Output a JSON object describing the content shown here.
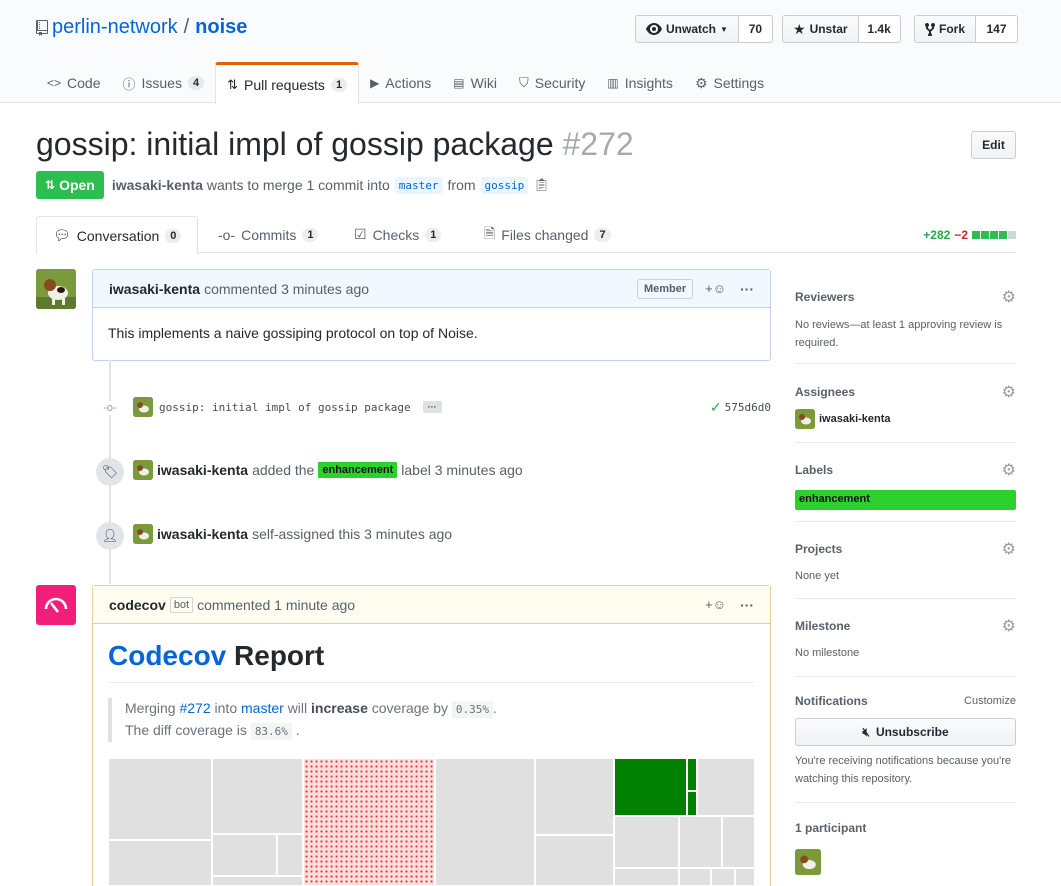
{
  "repo": {
    "owner": "perlin-network",
    "name": "noise"
  },
  "actions": [
    {
      "label": "Unwatch",
      "count": "70",
      "icon": "eye-icon"
    },
    {
      "label": "Unstar",
      "count": "1.4k",
      "icon": "star-icon"
    },
    {
      "label": "Fork",
      "count": "147",
      "icon": "fork-icon"
    }
  ],
  "reponav": [
    {
      "label": "Code",
      "count": ""
    },
    {
      "label": "Issues",
      "count": "4"
    },
    {
      "label": "Pull requests",
      "count": "1"
    },
    {
      "label": "Actions",
      "count": ""
    },
    {
      "label": "Wiki",
      "count": ""
    },
    {
      "label": "Security",
      "count": ""
    },
    {
      "label": "Insights",
      "count": ""
    },
    {
      "label": "Settings",
      "count": ""
    }
  ],
  "pr": {
    "title": "gossip: initial impl of gossip package",
    "number": "#272",
    "edit": "Edit",
    "state": "Open",
    "author": "iwasaki-kenta",
    "merge_text": "wants to merge 1 commit into",
    "base": "master",
    "from": "from",
    "head": "gossip"
  },
  "tabs": [
    {
      "label": "Conversation",
      "count": "0"
    },
    {
      "label": "Commits",
      "count": "1"
    },
    {
      "label": "Checks",
      "count": "1"
    },
    {
      "label": "Files changed",
      "count": "7"
    }
  ],
  "diffstat": {
    "add": "+282",
    "del": "−2"
  },
  "comment1": {
    "author": "iwasaki-kenta",
    "action": "commented 3 minutes ago",
    "role": "Member",
    "body": "This implements a naive gossiping protocol on top of Noise."
  },
  "timeline": {
    "commit_msg": "gossip: initial impl of gossip package",
    "commit_more": "···",
    "commit_sha": "575d6d0",
    "label_author": "iwasaki-kenta",
    "label_pre": "added the",
    "label_name": "enhancement",
    "label_post": "label 3 minutes ago",
    "assign_author": "iwasaki-kenta",
    "assign_text": "self-assigned this 3 minutes ago"
  },
  "comment2": {
    "author": "codecov",
    "bot": "bot",
    "action": "commented 1 minute ago",
    "h_link": "Codecov",
    "h_rest": "Report",
    "q1_pre": "Merging",
    "q1_pr": "#272",
    "q1_into": "into",
    "q1_branch": "master",
    "q1_will": "will",
    "q1_inc": "increase",
    "q1_cov": "coverage by",
    "q1_val": "0.35%",
    "q2_pre": "The diff coverage is",
    "q2_val": "83.6%"
  },
  "sidebar": {
    "reviewers": {
      "title": "Reviewers",
      "text": "No reviews—at least 1 approving review is required."
    },
    "assignees": {
      "title": "Assignees",
      "user": "iwasaki-kenta"
    },
    "labels": {
      "title": "Labels",
      "label": "enhancement"
    },
    "projects": {
      "title": "Projects",
      "text": "None yet"
    },
    "milestone": {
      "title": "Milestone",
      "text": "No milestone"
    },
    "notifications": {
      "title": "Notifications",
      "customize": "Customize",
      "button": "Unsubscribe",
      "text": "You're receiving notifications because you're watching this repository."
    },
    "participants": {
      "title": "1 participant"
    }
  },
  "colors": {
    "link": "#0366d6",
    "open": "#2cbe4e",
    "label": "#2cd12e",
    "tab_accent": "#e36209",
    "codecov": "#f01f7a",
    "coverage_green": "#008000"
  }
}
